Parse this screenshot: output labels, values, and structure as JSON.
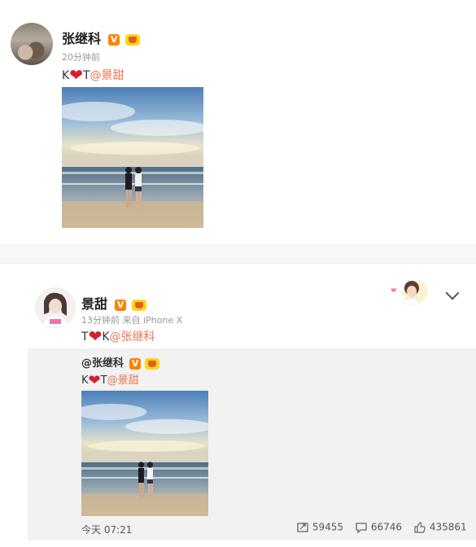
{
  "post1": {
    "author": "张继科",
    "time": "20分钟前",
    "text_k": "K",
    "text_t": "T",
    "mention": "@景甜"
  },
  "post2": {
    "author": "景甜",
    "time_source": "13分钟前 来自 iPhone X",
    "text_t": "T",
    "text_k": "K",
    "mention": "@张继科"
  },
  "repost": {
    "author": "@张继科",
    "text_k": "K",
    "text_t": "T",
    "mention": "@景甜"
  },
  "footer": {
    "date": "今天 07:21",
    "reposts": "59455",
    "comments": "66746",
    "likes": "435861"
  },
  "icons": {
    "verified": "verified-v-icon",
    "vip": "vip-crown-icon",
    "heart": "heart-icon",
    "repost": "repost-icon",
    "comment": "comment-icon",
    "like": "thumbs-up-icon",
    "more": "chevron-down-icon"
  },
  "colors": {
    "mention": "#eb7350",
    "verified_badge": "#ff8200",
    "heart": "#d71f2d",
    "repost_bg": "#f2f2f2"
  }
}
